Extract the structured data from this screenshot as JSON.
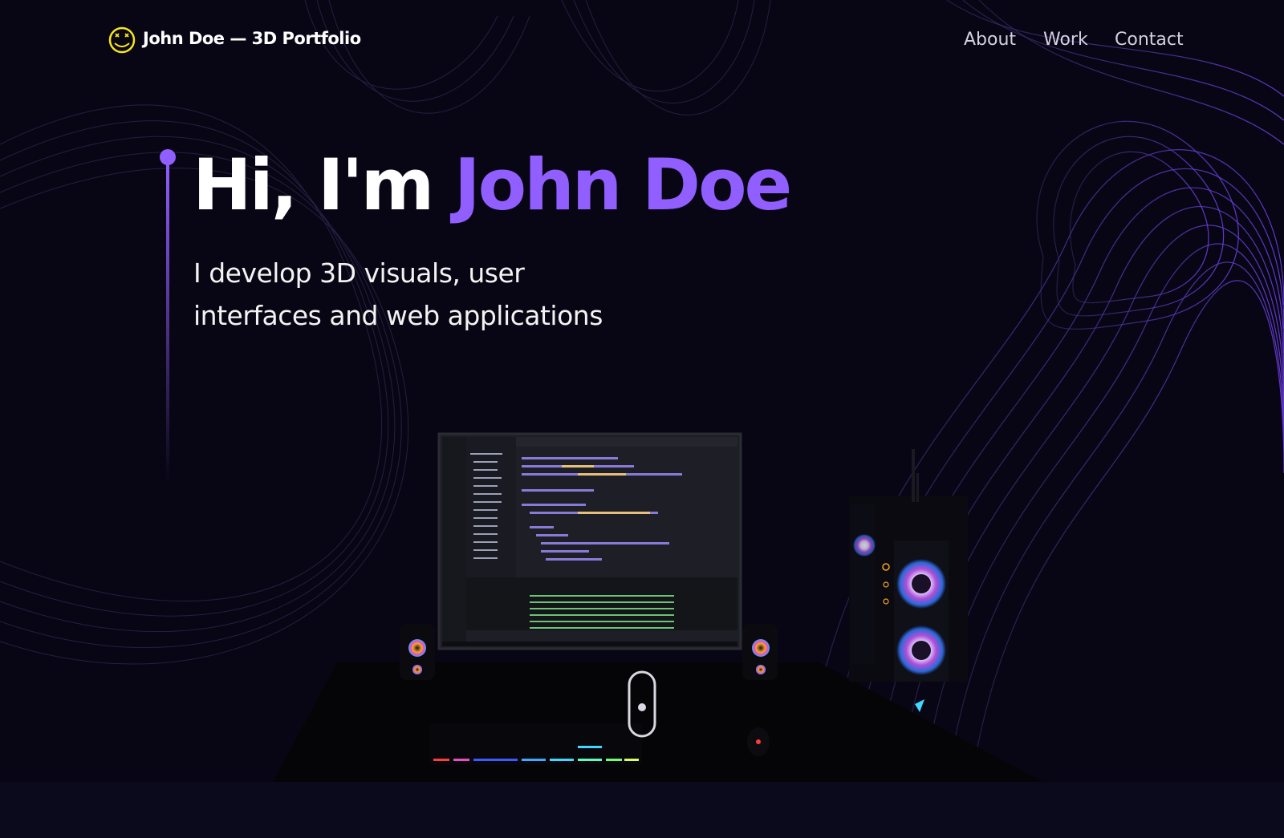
{
  "brand": {
    "name": "John Doe — 3D Portfolio",
    "logo_icon": "smiley-x-eyes-icon",
    "logo_color": "#f6e71a"
  },
  "nav": {
    "links": [
      "About",
      "Work",
      "Contact"
    ]
  },
  "hero": {
    "greeting": "Hi, I'm ",
    "name": "John Doe",
    "subtitle_line1": "I develop 3D visuals, user",
    "subtitle_line2": "interfaces and web applications"
  },
  "colors": {
    "background": "#080614",
    "accent": "#915eff",
    "text": "#ffffff",
    "nav_text": "#d4d0df"
  },
  "scene": {
    "description_icon": "desktop-computer-setup-icon"
  },
  "scroll": {
    "icon": "mouse-scroll-icon"
  }
}
